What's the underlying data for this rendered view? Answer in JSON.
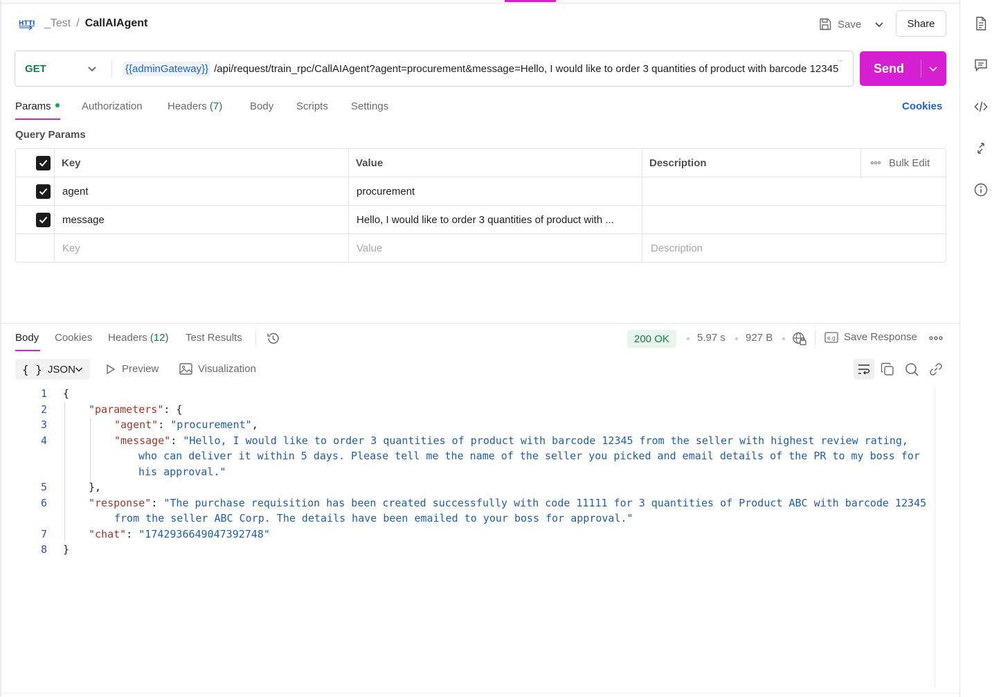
{
  "breadcrumb": {
    "collection": "_Test",
    "separator": "/",
    "request": "CallAIAgent"
  },
  "header": {
    "save_label": "Save",
    "share_label": "Share"
  },
  "request": {
    "method": "GET",
    "url_variable": "{{adminGateway}}",
    "url_path": "/api/request/train_rpc/CallAIAgent?agent=procurement&message=Hello, I would like to order 3 quantities of product with barcode 12345",
    "send_label": "Send"
  },
  "tabs": {
    "params": "Params",
    "authorization": "Authorization",
    "headers": "Headers",
    "headers_count": "(7)",
    "body": "Body",
    "scripts": "Scripts",
    "settings": "Settings",
    "cookies": "Cookies"
  },
  "query_params": {
    "label": "Query Params",
    "columns": {
      "key": "Key",
      "value": "Value",
      "description": "Description",
      "bulk_edit": "Bulk Edit"
    },
    "rows": [
      {
        "key": "agent",
        "value": "procurement"
      },
      {
        "key": "message",
        "value": "Hello, I would like to order 3 quantities of product with ..."
      }
    ],
    "placeholders": {
      "key": "Key",
      "value": "Value",
      "description": "Description"
    }
  },
  "response": {
    "tabs": {
      "body": "Body",
      "cookies": "Cookies",
      "headers": "Headers",
      "headers_count": "(12)",
      "test_results": "Test Results"
    },
    "status": "200 OK",
    "time": "5.97 s",
    "size": "927 B",
    "save_response": "Save Response",
    "format": "JSON",
    "preview": "Preview",
    "visualization": "Visualization"
  },
  "code": {
    "line_numbers": [
      "1",
      "2",
      "3",
      "4",
      "5",
      "6",
      "7",
      "8"
    ],
    "open_brace": "{",
    "close_brace": "}",
    "params_close": "},",
    "k_parameters": "\"parameters\"",
    "k_agent": "\"agent\"",
    "v_agent": "\"procurement\"",
    "k_message": "\"message\"",
    "v_message_1": "\"Hello, I would like to order 3 quantities of product with barcode 12345 from the seller with highest review rating,",
    "v_message_2": "who can deliver it within 5 days. Please tell me the name of the seller you picked and email details of the PR to my boss for",
    "v_message_3": "his approval.\"",
    "k_response": "\"response\"",
    "v_response_1": "\"The purchase requisition has been created successfully with code 11111 for 3 quantities of Product ABC with barcode 12345",
    "v_response_2": "from the seller ABC Corp. The details have been emailed to your boss for approval.\"",
    "k_chat": "\"chat\"",
    "v_chat": "\"1742936649047392748\""
  },
  "colors": {
    "accent": "#d51fd1",
    "status_green": "#1d7b4b",
    "link_blue": "#1f63c6",
    "json_key": "#a1372a",
    "json_string": "#1f5ea8"
  },
  "icons": {
    "request_type": "http-icon",
    "save": "floppy-disk-icon",
    "history": "history-icon",
    "network": "globe-lock-icon",
    "save_response": "example-icon",
    "wrap": "wrap-lines-icon",
    "copy": "copy-icon",
    "search": "search-icon",
    "link": "link-icon",
    "sidebar": [
      "document-icon",
      "comment-icon",
      "code-icon",
      "related-icon",
      "info-icon"
    ]
  }
}
